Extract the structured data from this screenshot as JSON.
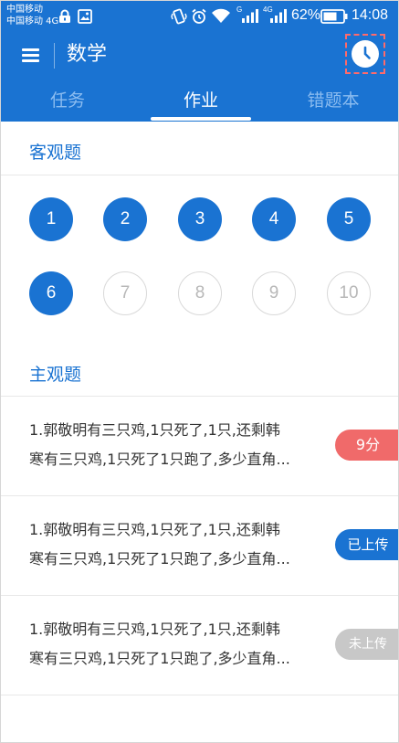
{
  "status_bar": {
    "carrier_line1": "中国移动",
    "carrier_line2": "中国移动 4G",
    "signal1_label": "G",
    "signal2_label": "4G",
    "battery_percent": "62%",
    "time": "14:08",
    "icons": [
      "lock-icon",
      "image-icon",
      "vibrate-icon",
      "alarm-icon",
      "wifi-icon",
      "signal-icon",
      "signal-icon",
      "battery-icon"
    ]
  },
  "app_bar": {
    "title": "数学",
    "menu_icon": "menu-icon",
    "history_icon": "clock-icon"
  },
  "tabs": {
    "items": [
      {
        "label": "任务",
        "active": false
      },
      {
        "label": "作业",
        "active": true
      },
      {
        "label": "错题本",
        "active": false
      }
    ]
  },
  "objective": {
    "title": "客观题",
    "questions": [
      {
        "num": "1",
        "done": true
      },
      {
        "num": "2",
        "done": true
      },
      {
        "num": "3",
        "done": true
      },
      {
        "num": "4",
        "done": true
      },
      {
        "num": "5",
        "done": true
      },
      {
        "num": "6",
        "done": true
      },
      {
        "num": "7",
        "done": false
      },
      {
        "num": "8",
        "done": false
      },
      {
        "num": "9",
        "done": false
      },
      {
        "num": "10",
        "done": false
      }
    ]
  },
  "subjective": {
    "title": "主观题",
    "items": [
      {
        "line1": "1.郭敬明有三只鸡,1只死了,1只,还剩韩",
        "line2": "寒有三只鸡,1只死了1只跑了,多少直角...",
        "badge": "9分",
        "badge_type": "score"
      },
      {
        "line1": "1.郭敬明有三只鸡,1只死了,1只,还剩韩",
        "line2": "寒有三只鸡,1只死了1只跑了,多少直角...",
        "badge": "已上传",
        "badge_type": "uploaded"
      },
      {
        "line1": "1.郭敬明有三只鸡,1只死了,1只,还剩韩",
        "line2": "寒有三只鸡,1只死了1只跑了,多少直角...",
        "badge": "未上传",
        "badge_type": "pending"
      }
    ]
  },
  "colors": {
    "primary": "#1a73d2",
    "tab_inactive": "#8bbcf0",
    "score_badge": "#f06a6a",
    "pending_badge": "#c8c8c8",
    "highlight_dashed": "#ff6a6a"
  }
}
